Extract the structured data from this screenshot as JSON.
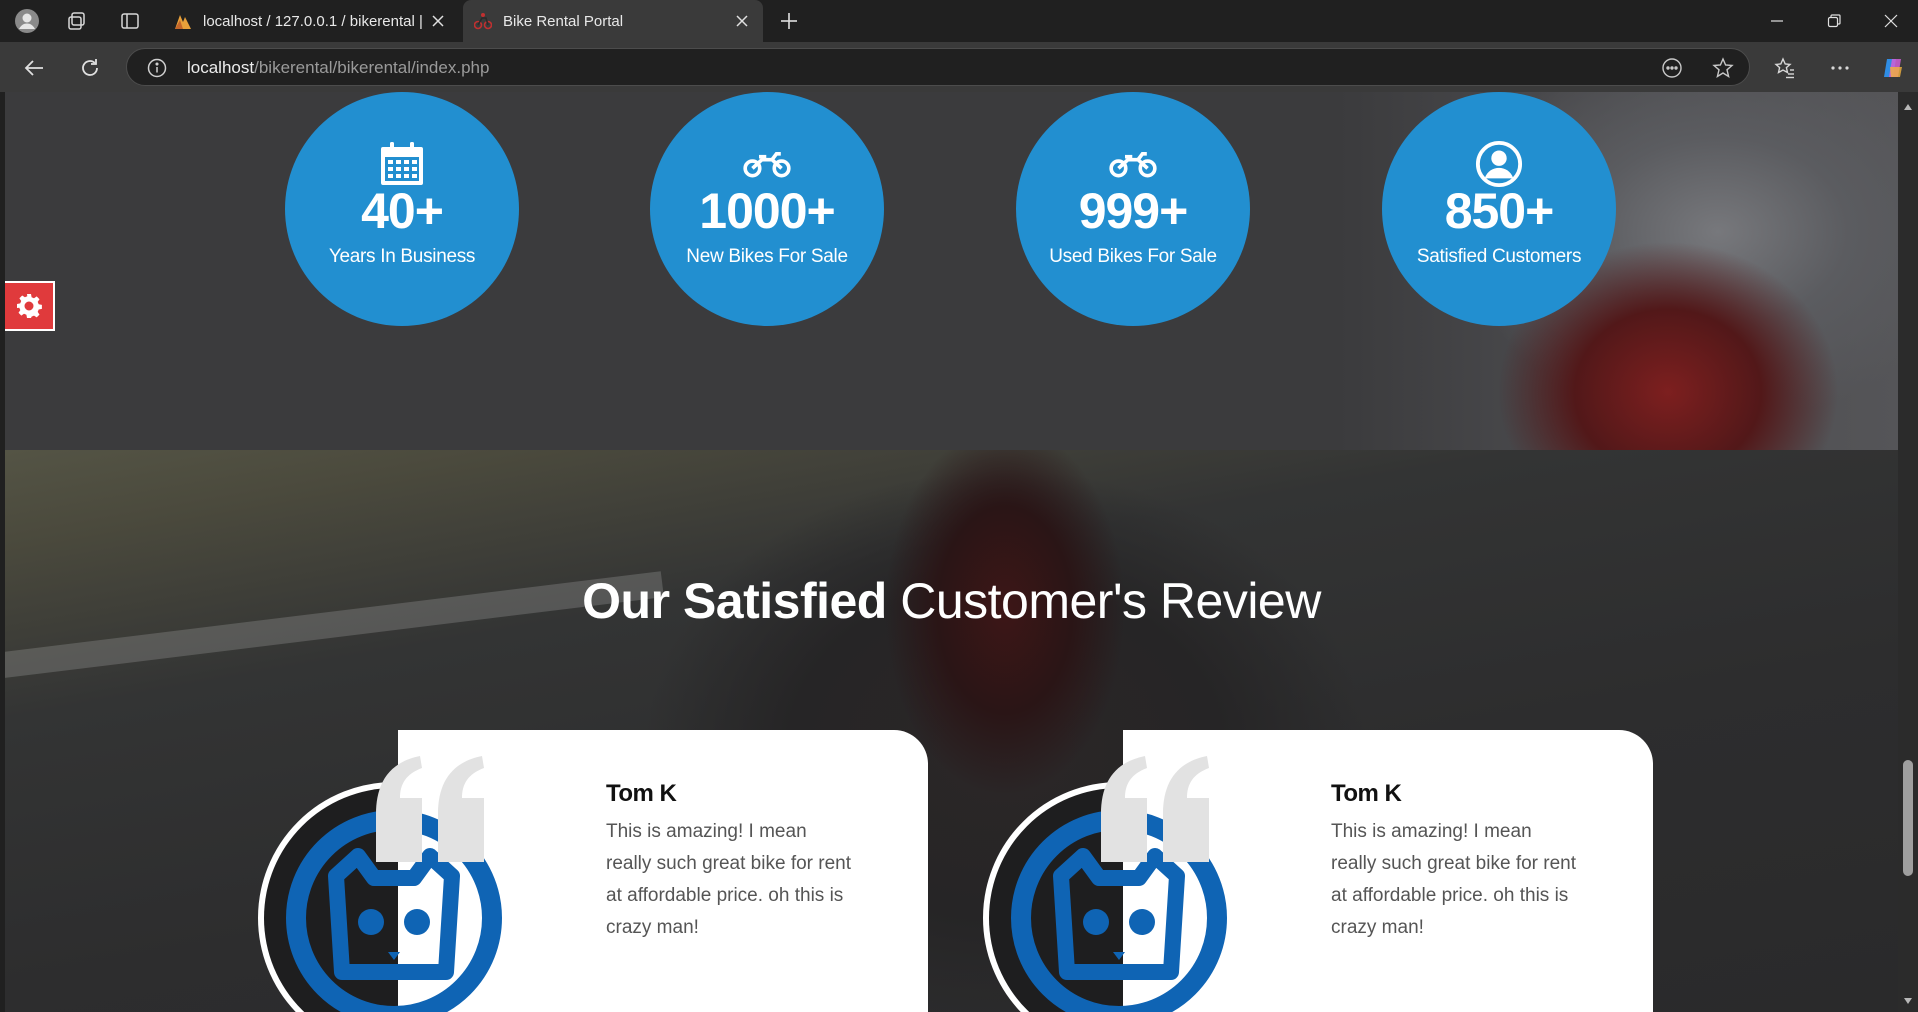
{
  "browser": {
    "tabs": [
      {
        "title": "localhost / 127.0.0.1 / bikerental |",
        "favicon": "phpmyadmin-icon",
        "active": false
      },
      {
        "title": "Bike Rental Portal",
        "favicon": "motorbike-icon",
        "active": true
      }
    ],
    "url": {
      "host": "localhost",
      "path": "/bikerental/bikerental/index.php"
    }
  },
  "stats": [
    {
      "icon": "calendar-icon",
      "value": "40+",
      "label": "Years In Business"
    },
    {
      "icon": "motorcycle-icon",
      "value": "1000+",
      "label": "New Bikes For Sale"
    },
    {
      "icon": "motorcycle-icon",
      "value": "999+",
      "label": "Used Bikes For Sale"
    },
    {
      "icon": "user-circle-icon",
      "value": "850+",
      "label": "Satisfied Customers"
    }
  ],
  "reviews_section": {
    "title_bold": "Our Satisfied",
    "title_light": " Customer's Review",
    "reviews": [
      {
        "name": "Tom K",
        "text": "This is amazing! I mean really such great bike for rent at affordable price. oh this is crazy man!"
      },
      {
        "name": "Tom K",
        "text": "This is amazing! I mean really such great bike for rent at affordable price. oh this is crazy man!"
      }
    ]
  },
  "colors": {
    "stat_circle": "#228fd0",
    "gear_button": "#e03a3c",
    "avatar_blue": "#0f64b4"
  }
}
